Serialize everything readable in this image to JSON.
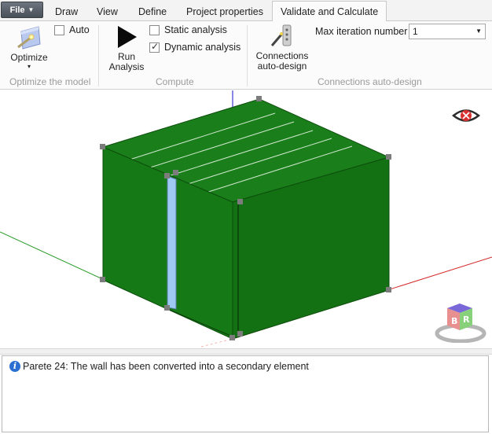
{
  "file_menu": {
    "label": "File"
  },
  "tabs": [
    {
      "label": "Draw",
      "active": false
    },
    {
      "label": "View",
      "active": false
    },
    {
      "label": "Define",
      "active": false
    },
    {
      "label": "Project properties",
      "active": false
    },
    {
      "label": "Validate and Calculate",
      "active": true
    }
  ],
  "ribbon": {
    "optimize_group": {
      "label": "Optimize the model",
      "optimize_button": "Optimize",
      "auto_checkbox": {
        "label": "Auto",
        "checked": false
      }
    },
    "compute_group": {
      "label": "Compute",
      "run_button_line1": "Run",
      "run_button_line2": "Analysis",
      "static_analysis": {
        "label": "Static analysis",
        "checked": false
      },
      "dynamic_analysis": {
        "label": "Dynamic analysis",
        "checked": true
      }
    },
    "connections_group": {
      "label": "Connections auto-design",
      "button_line1": "Connections",
      "button_line2": "auto-design",
      "max_iteration_label": "Max iteration number",
      "max_iteration_value": "1"
    }
  },
  "viewport": {
    "model_color": "#1a7a1a",
    "nav_cube_faces": [
      "B",
      "R"
    ]
  },
  "messages": [
    {
      "icon": "info-icon",
      "text": "Parete 24: The wall has been converted into a secondary element"
    }
  ]
}
